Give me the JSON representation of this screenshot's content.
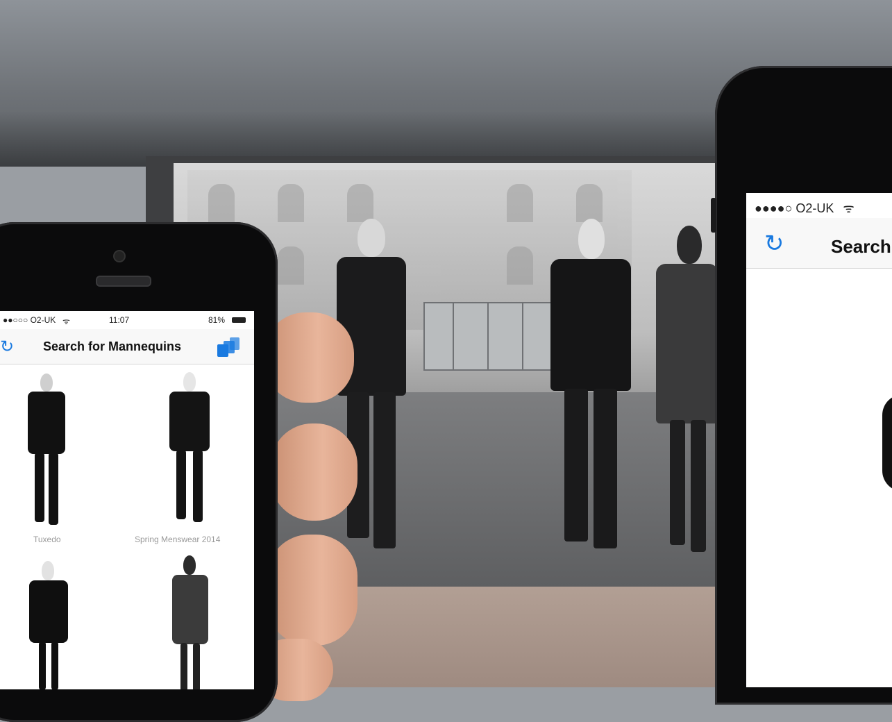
{
  "left_phone": {
    "status": {
      "carrier": "●●○○○ O2-UK",
      "wifi": "ᯤ",
      "time": "11:07",
      "battery": "81%"
    },
    "nav": {
      "title": "Search for Mannequins",
      "refresh_icon": "refresh-icon",
      "stack_icon": "stack-icon"
    },
    "items": [
      {
        "label": "Tuxedo"
      },
      {
        "label": "Spring Menswear 2014"
      },
      {
        "label": ""
      },
      {
        "label": ""
      }
    ]
  },
  "right_phone": {
    "status": {
      "carrier": "●●●●○ O2-UK",
      "wifi": "ᯤ"
    },
    "nav": {
      "title": "Search",
      "refresh_icon": "refresh-icon"
    }
  },
  "colors": {
    "accent": "#1a7ae0"
  }
}
